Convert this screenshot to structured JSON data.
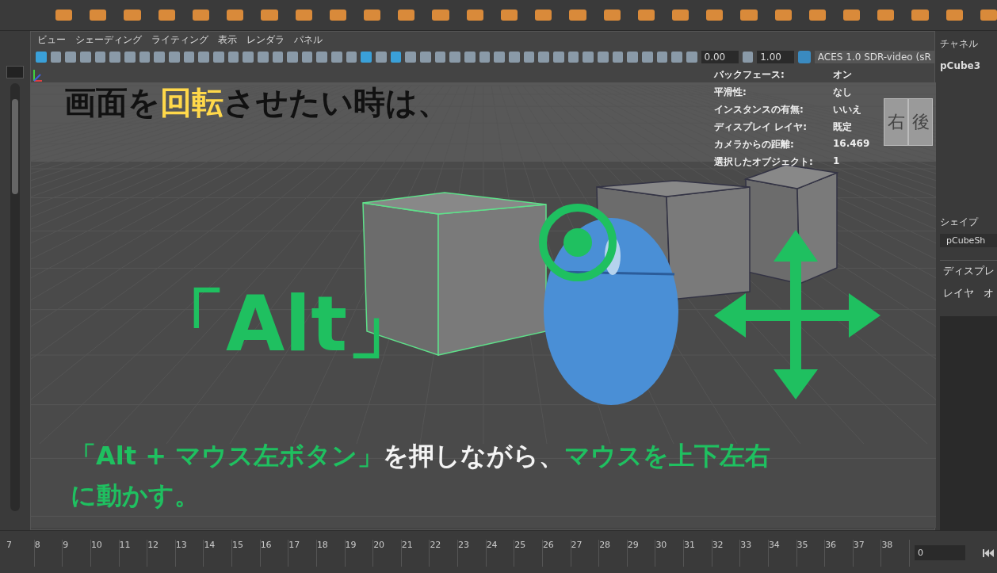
{
  "viewport": {
    "menu": [
      "ビュー",
      "シェーディング",
      "ライティング",
      "表示",
      "レンダラ",
      "パネル"
    ],
    "toolbar": {
      "fields": [
        "0.00",
        "1.00"
      ],
      "color_space": "ACES 1.0 SDR-video (sR"
    },
    "hud": [
      {
        "label": "バックフェース:",
        "value": "オン"
      },
      {
        "label": "平滑性:",
        "value": "なし"
      },
      {
        "label": "インスタンスの有無:",
        "value": "いいえ"
      },
      {
        "label": "ディスプレイ レイヤ:",
        "value": "既定"
      },
      {
        "label": "カメラからの距離:",
        "value": "16.469"
      },
      {
        "label": "選択したオブジェクト:",
        "value": "1"
      }
    ],
    "view_cube": {
      "faces": [
        "右",
        "後"
      ]
    },
    "caption": [
      {
        "text": "画面を",
        "highlight": false
      },
      {
        "text": "回転",
        "highlight": true
      },
      {
        "text": "させたい時は、",
        "highlight": false
      }
    ],
    "key_label": "「Alt」",
    "instruction": [
      [
        {
          "text": "「Alt + マウス左ボタン」",
          "highlight": true
        },
        {
          "text": "を押しながら、",
          "highlight": false
        },
        {
          "text": "マウスを上下左右",
          "highlight": true
        }
      ],
      [
        {
          "text": "に動かす。",
          "highlight": true
        }
      ]
    ]
  },
  "channel_box": {
    "title": "チャネル",
    "object": "pCube3",
    "shape_label": "シェイプ",
    "shape": "pCubeSh",
    "layer_tab": "ディスプレ",
    "layer_menu": [
      "レイヤ",
      "オ"
    ]
  },
  "timeline": {
    "frames": [
      "7",
      "8",
      "9",
      "10",
      "11",
      "12",
      "13",
      "14",
      "15",
      "16",
      "17",
      "18",
      "19",
      "20",
      "21",
      "22",
      "23",
      "24",
      "25",
      "26",
      "27",
      "28",
      "29",
      "30",
      "31",
      "32",
      "33",
      "34",
      "35",
      "36",
      "37",
      "38"
    ],
    "current_frame": "0"
  }
}
